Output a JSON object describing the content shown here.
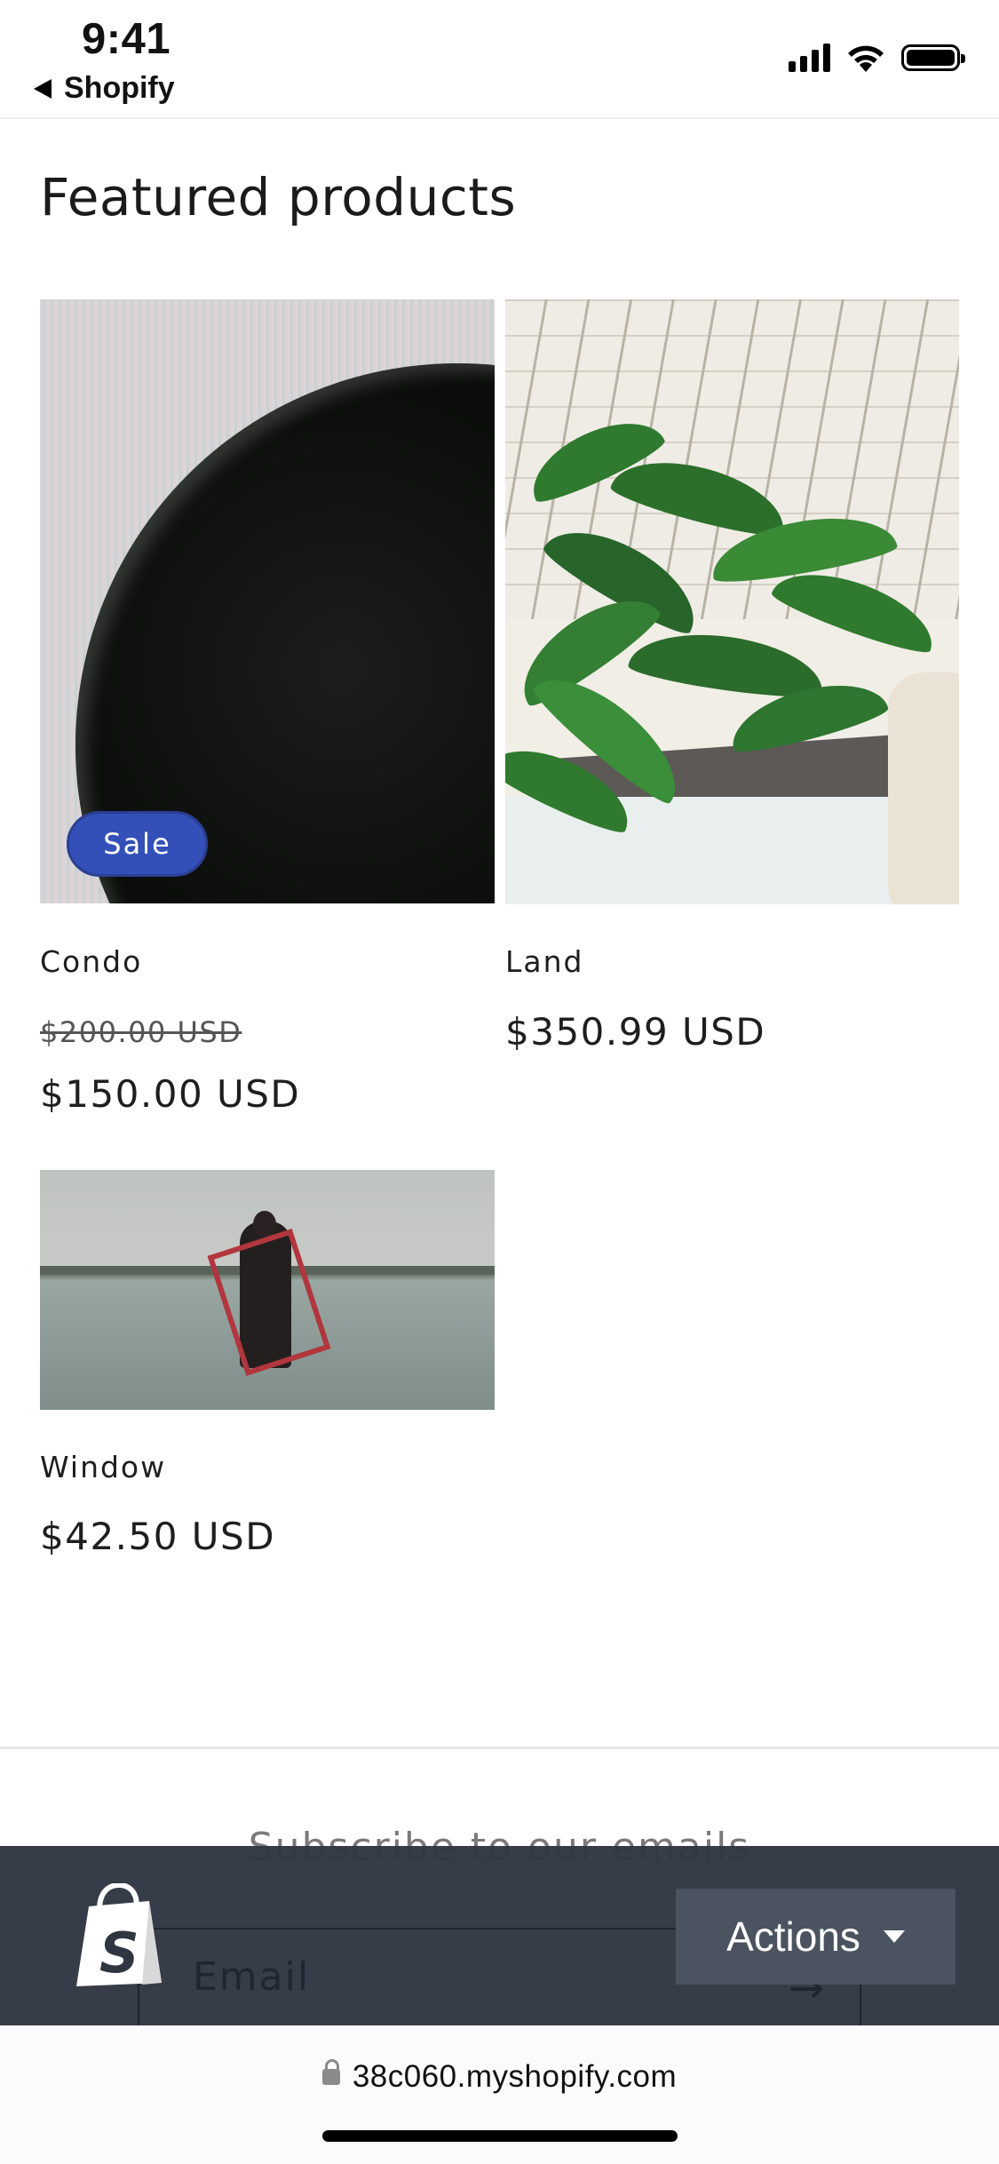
{
  "status_bar": {
    "time": "9:41",
    "back_label": "Shopify"
  },
  "section": {
    "title": "Featured products"
  },
  "products": [
    {
      "name": "Condo",
      "badge": "Sale",
      "compare_price": "$200.00 USD",
      "price": "$150.00 USD"
    },
    {
      "name": "Land",
      "price": "$350.99 USD"
    },
    {
      "name": "Window",
      "price": "$42.50 USD"
    }
  ],
  "newsletter": {
    "title": "Subscribe to our emails",
    "email_placeholder": "Email"
  },
  "shopify_bar": {
    "actions_label": "Actions"
  },
  "browser": {
    "url": "38c060.myshopify.com"
  },
  "icons": [
    "back-triangle-icon",
    "signal-icon",
    "wifi-icon",
    "battery-icon",
    "shopify-bag-icon",
    "caret-down-icon",
    "arrow-right-icon",
    "lock-icon"
  ],
  "colors": {
    "sale_badge": "#3350b8",
    "shopify_bar": "#2f3642",
    "actions_button": "#4a535f"
  }
}
